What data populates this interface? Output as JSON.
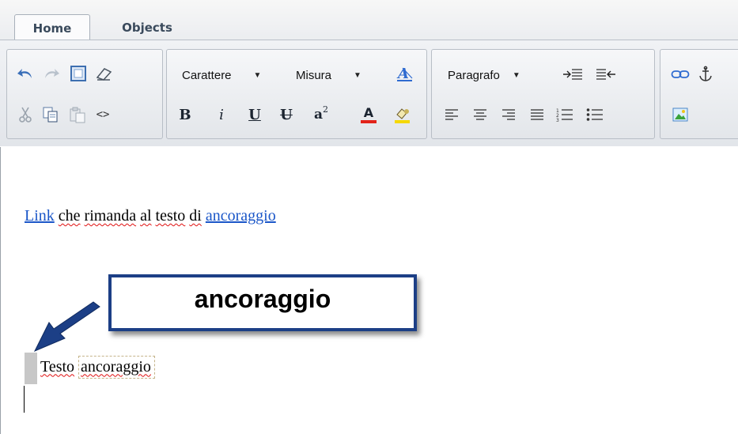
{
  "tabs": [
    {
      "label": "Home",
      "active": true
    },
    {
      "label": "Objects",
      "active": false
    }
  ],
  "toolbar": {
    "font_select": "Carattere",
    "size_select": "Misura",
    "paragraph_select": "Paragrafo",
    "bold": "B",
    "italic": "i",
    "underline": "U",
    "strike": "U",
    "superscript_base": "a",
    "superscript_exp": "2",
    "font_color": "A",
    "source": "<>"
  },
  "editor": {
    "line1": {
      "link1": "Link",
      "mid_words": [
        "che",
        "rimanda",
        "al",
        "testo",
        "di"
      ],
      "link2": "ancoraggio"
    },
    "line2": {
      "word1": "Testo",
      "word2": "ancoraggio"
    }
  },
  "callout": {
    "text": "ancoraggio"
  },
  "colors": {
    "link": "#1a56c8",
    "callout_border": "#1c3f86",
    "spellcheck": "#e01010"
  }
}
